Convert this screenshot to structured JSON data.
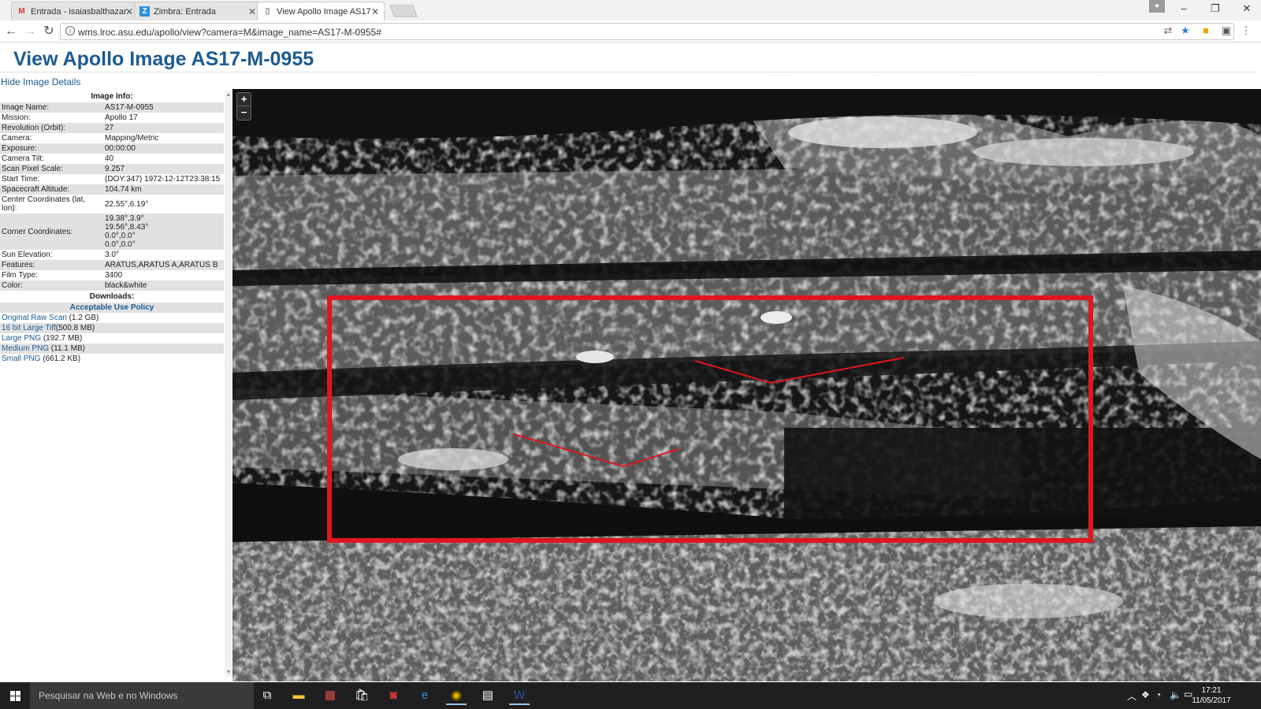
{
  "browser": {
    "tabs": [
      {
        "title": "Entrada - isaiasbalthazar",
        "icon": "gmail-icon",
        "active": false
      },
      {
        "title": "Zimbra: Entrada",
        "icon": "zimbra-icon",
        "active": false
      },
      {
        "title": "View Apollo Image AS17",
        "icon": "page-icon",
        "active": true
      }
    ],
    "url": "wms.lroc.asu.edu/apollo/view?camera=M&image_name=AS17-M-0955#"
  },
  "page": {
    "title": "View Apollo Image AS17-M-0955",
    "hide_link": "Hide Image Details",
    "image_info_header": "Image Info:",
    "info_rows": [
      {
        "key": "Image Name:",
        "value": "AS17-M-0955"
      },
      {
        "key": "Mission:",
        "value": "Apollo 17"
      },
      {
        "key": "Revolution (Orbit):",
        "value": "27"
      },
      {
        "key": "Camera:",
        "value": "Mapping/Metric"
      },
      {
        "key": "Exposure:",
        "value": "00:00:00"
      },
      {
        "key": "Camera Tilt:",
        "value": "40"
      },
      {
        "key": "Scan Pixel Scale:",
        "value": "9.257"
      },
      {
        "key": "Start Time:",
        "value": "(DOY:347) 1972-12-12T23:38:15"
      },
      {
        "key": "Spacecraft Altitude:",
        "value": "104.74 km"
      },
      {
        "key": "Center Coordinates (lat, lon):",
        "value": "22.55°,6.19°"
      },
      {
        "key": "Corner Coordinates:",
        "value": [
          "19.38°,3.9°",
          "19.56°,8.43°",
          "0.0°,0.0°",
          "0.0°,0.0°"
        ]
      },
      {
        "key": "Sun Elevation:",
        "value": "3.0°"
      },
      {
        "key": "Features:",
        "value": "ARATUS,ARATUS A,ARATUS B"
      },
      {
        "key": "Film Type:",
        "value": "3400"
      },
      {
        "key": "Color:",
        "value": "black&white"
      }
    ],
    "downloads_header": "Downloads:",
    "policy_link": "Acceptable Use Policy",
    "downloads": [
      {
        "label": "Original Raw Scan",
        "size": "(1.2 GB)"
      },
      {
        "label": "16 bit Large Tiff",
        "size": "(500.8 MB)"
      },
      {
        "label": "Large PNG",
        "size": "(192.7 MB)"
      },
      {
        "label": "Medium PNG",
        "size": "(11.1 MB)"
      },
      {
        "label": "Small PNG",
        "size": "(661.2 KB)"
      }
    ],
    "zoom_in": "+",
    "zoom_out": "−"
  },
  "taskbar": {
    "search_placeholder": "Pesquisar na Web e no Windows",
    "time": "17:21",
    "date": "11/05/2017"
  },
  "colors": {
    "link": "#1d5b91",
    "annotation": "#e0161e",
    "row_shade": "#e1e1e1"
  }
}
